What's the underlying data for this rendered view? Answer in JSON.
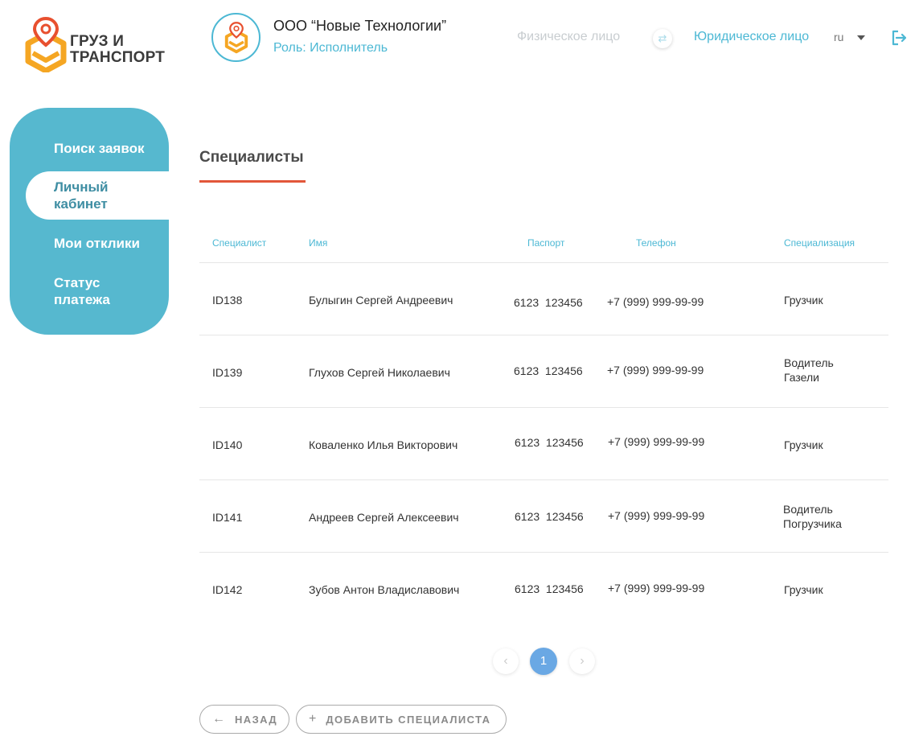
{
  "logo": {
    "line1": "ГРУЗ И",
    "line2": "ТРАНСПОРТ"
  },
  "company": {
    "name": "ООО “Новые Технологии”",
    "role": "Роль: Исполнитель"
  },
  "account_switch": {
    "individual": "Физическое лицо",
    "swap_icon": "⇄",
    "legal": "Юридическое лицо"
  },
  "language": "ru",
  "sidebar": {
    "items": [
      {
        "label": "Поиск заявок"
      },
      {
        "label": "Личный кабинет"
      },
      {
        "label": "Мои отклики"
      },
      {
        "label": "Статус платежа"
      }
    ]
  },
  "page_title": "Специалисты",
  "table": {
    "headers": [
      "Специалист",
      "Имя",
      "Паспорт",
      "Телефон",
      "Специализация"
    ],
    "rows": [
      {
        "id": "ID138",
        "name": "Булыгин Сергей Андреевич",
        "passport": "6123  123456",
        "phone": "+7 (999) 999-99-99",
        "spec": "Грузчик"
      },
      {
        "id": "ID139",
        "name": "Глухов Сергей Николаевич",
        "passport": "6123  123456",
        "phone": "+7 (999) 999-99-99",
        "spec": "Водитель Газели"
      },
      {
        "id": "ID140",
        "name": "Коваленко Илья Викторович",
        "passport": "6123  123456",
        "phone": "+7 (999) 999-99-99",
        "spec": "Грузчик"
      },
      {
        "id": "ID141",
        "name": "Андреев Сергей Алексеевич",
        "passport": "6123  123456",
        "phone": "+7 (999) 999-99-99",
        "spec": "Водитель Погрузчика"
      },
      {
        "id": "ID142",
        "name": "Зубов Антон Владиславович",
        "passport": "6123  123456",
        "phone": "+7 (999) 999-99-99",
        "spec": "Грузчик"
      }
    ]
  },
  "pagination": {
    "prev": "‹",
    "current": "1",
    "next": "›"
  },
  "buttons": {
    "back": "НАЗАД",
    "back_icon": "←",
    "add": "ДОБАВИТЬ СПЕЦИАЛИСТА",
    "add_icon": "+"
  },
  "colors": {
    "accent": "#4cb8d4",
    "sidebar": "#56b8cf",
    "underline": "#e2573a",
    "page_active": "#6aa8e4",
    "logo_orange": "#f5a623",
    "logo_red": "#e8502f"
  }
}
